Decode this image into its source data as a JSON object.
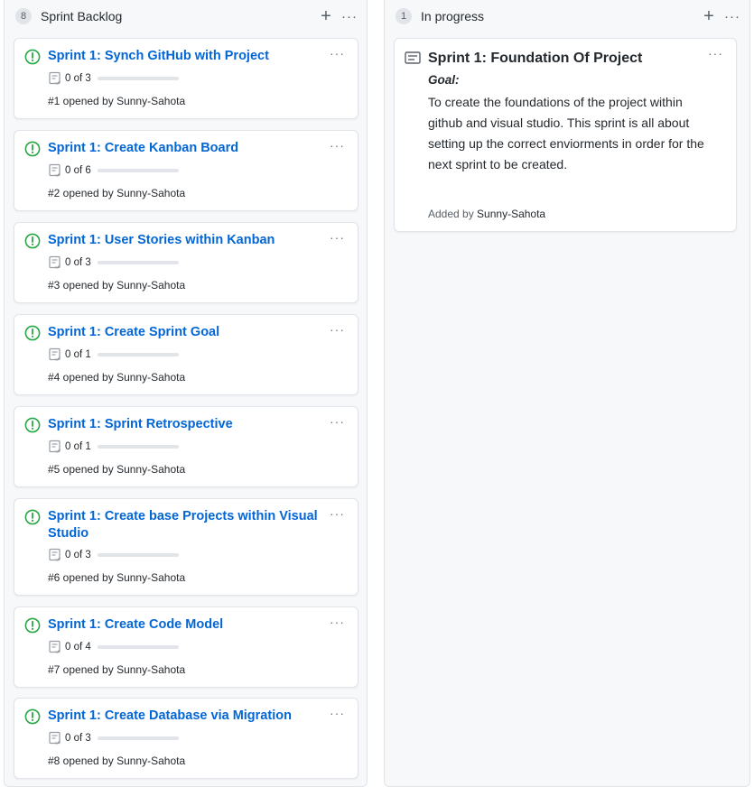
{
  "columns": {
    "backlog": {
      "count": "8",
      "title": "Sprint Backlog",
      "add_icon": "+",
      "menu_icon": "···",
      "cards": [
        {
          "title": "Sprint 1: Synch GitHub with Project",
          "progress": "0 of 3",
          "progress_fraction": 0,
          "opened": "#1 opened by Sunny-Sahota"
        },
        {
          "title": "Sprint 1: Create Kanban Board",
          "progress": "0 of 6",
          "progress_fraction": 0,
          "opened": "#2 opened by Sunny-Sahota"
        },
        {
          "title": "Sprint 1: User Stories within Kanban",
          "progress": "0 of 3",
          "progress_fraction": 0,
          "opened": "#3 opened by Sunny-Sahota"
        },
        {
          "title": "Sprint 1: Create Sprint Goal",
          "progress": "0 of 1",
          "progress_fraction": 0,
          "opened": "#4 opened by Sunny-Sahota"
        },
        {
          "title": "Sprint 1: Sprint Retrospective",
          "progress": "0 of 1",
          "progress_fraction": 0,
          "opened": "#5 opened by Sunny-Sahota"
        },
        {
          "title": "Sprint 1: Create base Projects within Visual Studio",
          "progress": "0 of 3",
          "progress_fraction": 0,
          "opened": "#6 opened by Sunny-Sahota"
        },
        {
          "title": "Sprint 1: Create Code Model",
          "progress": "0 of 4",
          "progress_fraction": 0,
          "opened": "#7 opened by Sunny-Sahota"
        },
        {
          "title": "Sprint 1: Create Database via Migration",
          "progress": "0 of 3",
          "progress_fraction": 0,
          "opened": "#8 opened by Sunny-Sahota"
        }
      ]
    },
    "in_progress": {
      "count": "1",
      "title": "In progress",
      "add_icon": "+",
      "menu_icon": "···",
      "note": {
        "title": "Sprint 1: Foundation Of Project",
        "goal_label": "Goal:",
        "body": "To create the foundations of the project within github and visual studio. This sprint is all about setting up the correct enviorments in order for the next sprint to be created.",
        "added_prefix": "Added by ",
        "added_author": "Sunny-Sahota",
        "menu_icon": "···"
      }
    }
  },
  "card_menu_icon": "···",
  "colors": {
    "issue_open": "#28a745",
    "link": "#0366d6",
    "column_bg": "#f6f8fa"
  },
  "icons": {
    "issue": "issue-opened-icon",
    "checklist": "checklist-icon",
    "note": "note-icon",
    "add": "plus-icon",
    "menu": "kebab-horizontal-icon"
  }
}
